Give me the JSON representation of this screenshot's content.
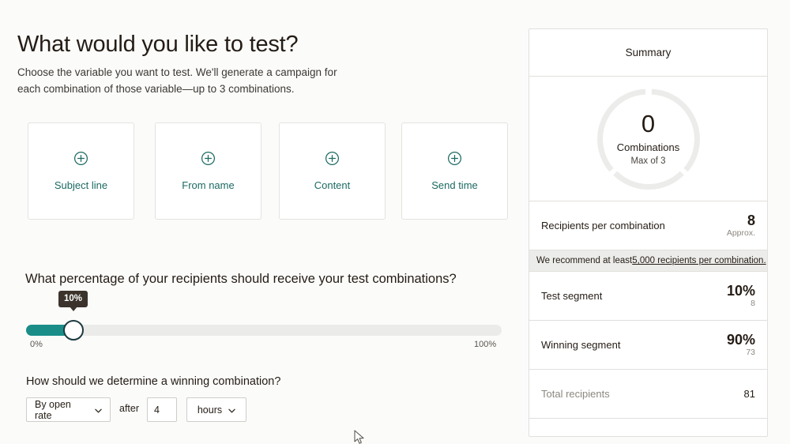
{
  "page": {
    "title": "What would you like to test?",
    "subtitle": "Choose the variable you want to test. We'll generate a campaign for each combination of those variable—up to 3 combinations."
  },
  "variables": {
    "cards": [
      {
        "label": "Subject line",
        "icon": "plus-circle-icon"
      },
      {
        "label": "From name",
        "icon": "plus-circle-icon"
      },
      {
        "label": "Content",
        "icon": "plus-circle-icon"
      },
      {
        "label": "Send time",
        "icon": "plus-circle-icon"
      }
    ]
  },
  "percentage": {
    "question": "What percentage of your recipients should receive your test combinations?",
    "value": "10%",
    "value_percent": 10,
    "min_label": "0%",
    "max_label": "100%",
    "fill_color": "#1a8d89",
    "track_color": "#ebebea",
    "tooltip_color": "#3b332c"
  },
  "winner": {
    "question": "How should we determine a winning combination?",
    "metric": "By open rate",
    "after_label": "after",
    "duration": "4",
    "unit": "hours",
    "chevron": "chevron-down-icon"
  },
  "summary": {
    "title": "Summary",
    "donut": {
      "count": "0",
      "caption": "Combinations",
      "max_label": "Max of 3",
      "segments": 3,
      "filled": 0,
      "ring_color": "#ececea"
    },
    "rows": [
      {
        "label": "Recipients per combination",
        "value": "8",
        "sub": "Approx."
      },
      {
        "label": "Test segment",
        "value": "10%",
        "sub": "8"
      },
      {
        "label": "Winning segment",
        "value": "90%",
        "sub": "73"
      },
      {
        "label": "Total recipients",
        "value": "81",
        "sub": ""
      }
    ],
    "recommendation": {
      "prefix": "We recommend at least ",
      "link": "5,000 recipients per combination."
    }
  }
}
